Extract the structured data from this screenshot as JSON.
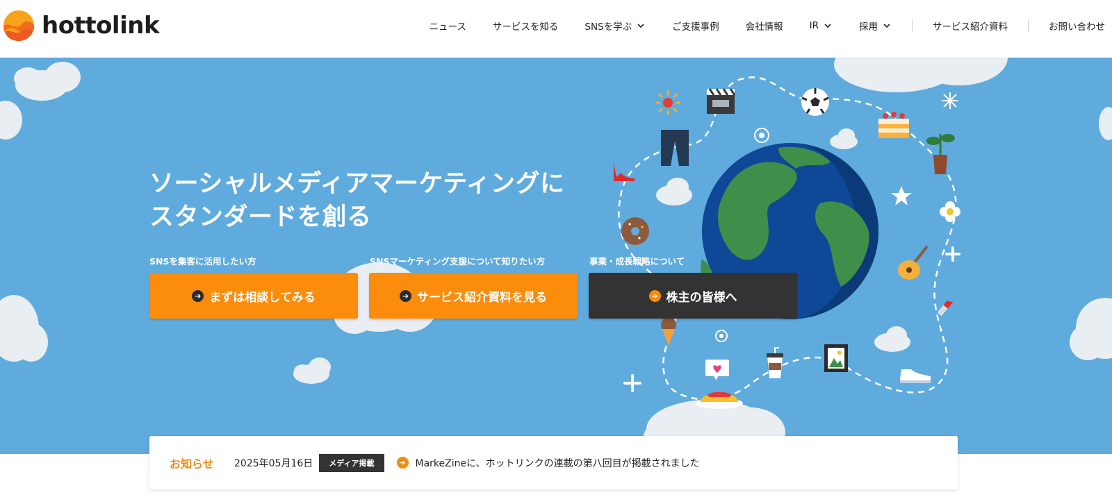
{
  "header": {
    "logo_text": "hottolink",
    "nav": [
      {
        "label": "ニュース",
        "dropdown": false
      },
      {
        "label": "サービスを知る",
        "dropdown": false
      },
      {
        "label": "SNSを学ぶ",
        "dropdown": true
      },
      {
        "label": "ご支援事例",
        "dropdown": false
      },
      {
        "label": "会社情報",
        "dropdown": false
      },
      {
        "label": "IR",
        "dropdown": true
      },
      {
        "label": "採用",
        "dropdown": true
      },
      {
        "label": "サービス紹介資料",
        "dropdown": false
      },
      {
        "label": "お問い合わせ",
        "dropdown": false
      }
    ]
  },
  "hero": {
    "title_line1": "ソーシャルメディアマーケティングに",
    "title_line2": "スタンダードを創る",
    "ctas": [
      {
        "caption": "SNSを集客に活用したい方",
        "label": "まずは相談してみる",
        "style": "orange"
      },
      {
        "caption": "SNSマーケティング支援について知りたい方",
        "label": "サービス紹介資料を見る",
        "style": "orange"
      },
      {
        "caption": "事業・成長戦略について",
        "label": "株主の皆様へ",
        "style": "dark"
      }
    ],
    "icons": [
      "sun-icon",
      "clapperboard-icon",
      "soccer-ball-icon",
      "cake-icon",
      "plant-icon",
      "pants-icon",
      "high-heel-icon",
      "star-icon",
      "flower-icon",
      "donut-icon",
      "guitar-icon",
      "lipstick-icon",
      "ice-cream-icon",
      "coffee-cup-icon",
      "picture-frame-icon",
      "sneaker-icon",
      "omelette-icon",
      "heart-speech-icon",
      "globe-icon"
    ]
  },
  "news": {
    "label": "お知らせ",
    "date": "2025年05月16日",
    "tag": "メディア掲載",
    "headline": "MarkeZineに、ホットリンクの連載の第八回目が掲載されました"
  },
  "colors": {
    "accent": "#fb8c0c",
    "hero_bg": "#5fabde",
    "dark_button": "#333333"
  }
}
